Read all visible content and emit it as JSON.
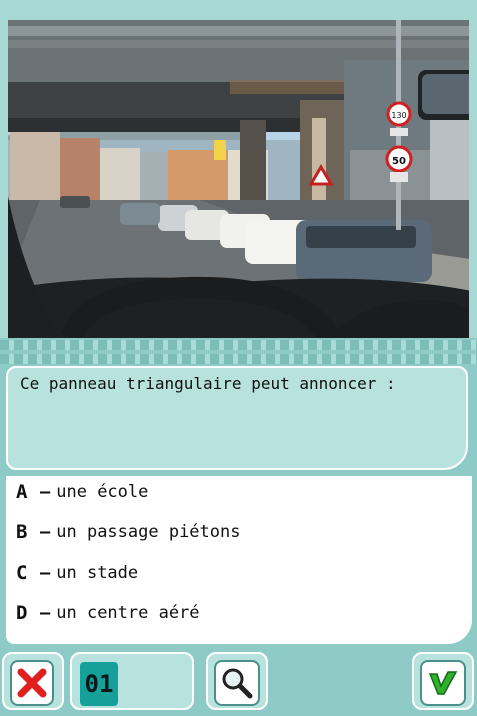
{
  "question": {
    "text": "Ce panneau triangulaire peut annoncer :"
  },
  "answers": [
    {
      "letter": "A",
      "text": "une école"
    },
    {
      "letter": "B",
      "text": "un passage piétons"
    },
    {
      "letter": "C",
      "text": "un stade"
    },
    {
      "letter": "D",
      "text": "un centre aéré"
    }
  ],
  "counter": "01",
  "road_signs": {
    "upper": "130",
    "lower": "50"
  },
  "icons": {
    "cancel": "red-x-icon",
    "zoom": "magnifier-icon",
    "confirm": "green-check-icon"
  },
  "colors": {
    "frame": "#8ecbc6",
    "panel": "#b7e2dd",
    "counter": "#16a09a",
    "cancel": "#e02020",
    "confirm": "#2fb02f"
  }
}
